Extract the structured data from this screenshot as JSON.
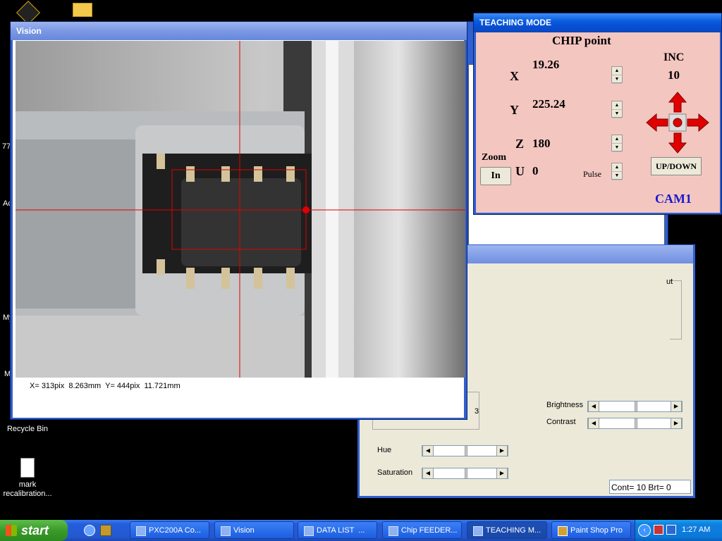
{
  "desktop": {
    "icons": [
      {
        "label": "Recycle Bin"
      },
      {
        "label": "mark recalibration..."
      }
    ],
    "partial_labels": [
      "77",
      "Ac",
      "My",
      "M"
    ]
  },
  "vision": {
    "title": "Vision",
    "status_text": "X= 313pix  8.263mm  Y= 444pix  11.721mm"
  },
  "teaching": {
    "title": "TEACHING MODE",
    "point_label": "CHIP point",
    "x_label": "X",
    "x_value": "19.26",
    "y_label": "Y",
    "y_value": "225.24",
    "z_label": "Z",
    "z_value": "180",
    "u_label": "U",
    "u_value": "0",
    "zoom_label": "Zoom",
    "zoom_button": "In",
    "pulse_label": "Pulse",
    "inc_label": "INC",
    "inc_value": "10",
    "updown_button": "UP/DOWN",
    "camera_label": "CAM1",
    "colors": {
      "bg": "#f4c6c0",
      "accent": "#1a1acc",
      "arrow": "#e00000"
    }
  },
  "camera_settings": {
    "number_value": "3",
    "brightness_label": "Brightness",
    "contrast_label": "Contrast",
    "hue_label": "Hue",
    "saturation_label": "Saturation",
    "status": "Cont= 10 Brt= 0",
    "partial_label": "ut"
  },
  "taskbar": {
    "start_label": "start",
    "clock": "1:27 AM",
    "buttons": [
      {
        "label": "PXC200A Co..."
      },
      {
        "label": "Vision"
      },
      {
        "label": "DATA LIST  ..."
      },
      {
        "label": "Chip FEEDER..."
      },
      {
        "label": "TEACHING M..."
      },
      {
        "label": "Paint Shop Pro"
      }
    ]
  }
}
